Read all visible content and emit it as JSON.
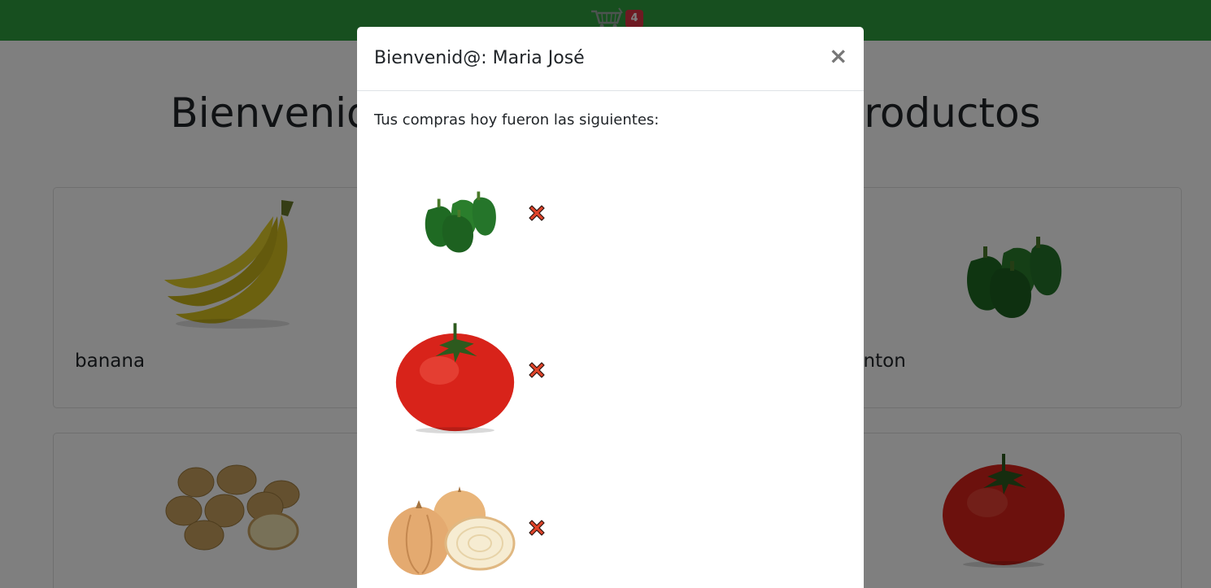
{
  "header": {
    "cart_count": "4",
    "cart_icon": "shopping-cart-icon",
    "bar_color": "#2e9e3e"
  },
  "page": {
    "title": "Bienvenido a la tienda, mira sus productos"
  },
  "products": [
    {
      "label": "banana",
      "icon": "banana-icon"
    },
    {
      "label": "pimenton",
      "icon": "green-pepper-icon"
    },
    {
      "label": "papa",
      "icon": "potato-icon"
    },
    {
      "label": "tomate",
      "icon": "tomato-icon"
    }
  ],
  "modal": {
    "title": "Bienvenid@: Maria José",
    "intro": "Tus compras hoy fueron las siguientes:",
    "close_label": "×",
    "items": [
      {
        "icon": "green-pepper-icon",
        "remove_icon": "remove-x-icon"
      },
      {
        "icon": "tomato-icon",
        "remove_icon": "remove-x-icon"
      },
      {
        "icon": "onion-icon",
        "remove_icon": "remove-x-icon"
      }
    ]
  },
  "colors": {
    "remove": "#e0442a",
    "badge": "#dc3545"
  }
}
